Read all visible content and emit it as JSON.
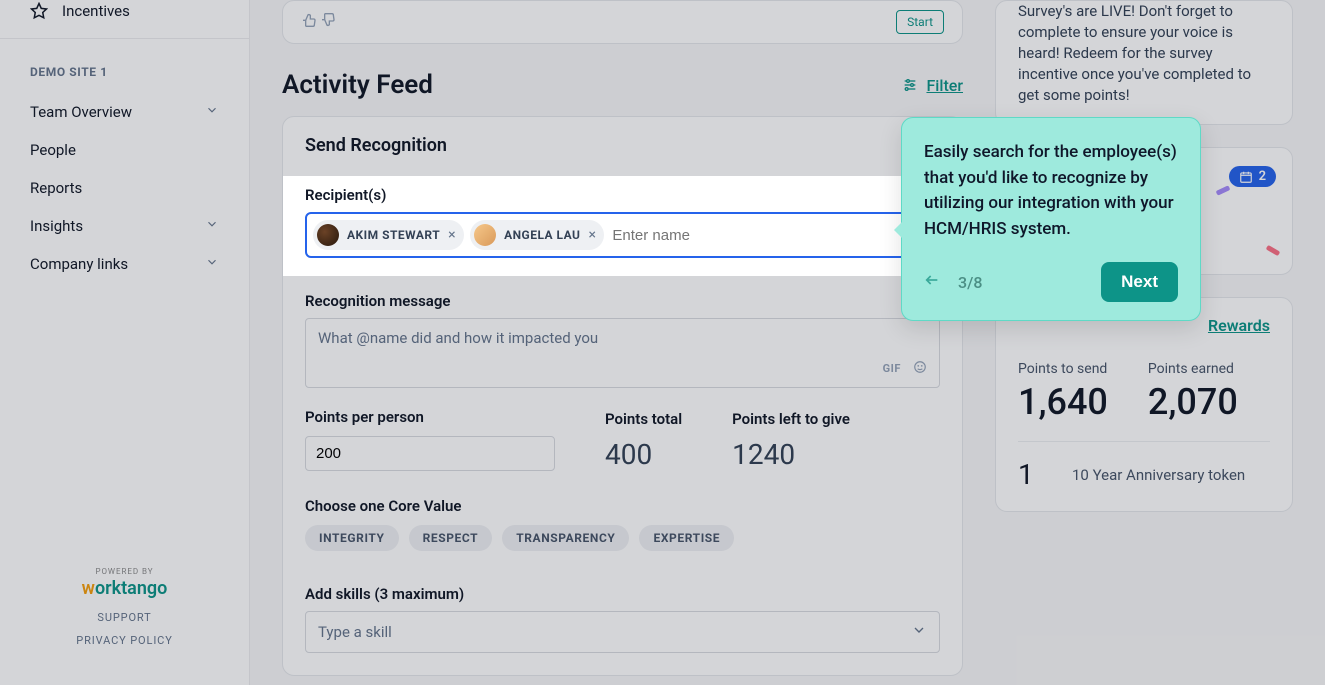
{
  "sidebar": {
    "incentives_label": "Incentives",
    "site_label": "DEMO SITE 1",
    "items": [
      {
        "label": "Team Overview",
        "expandable": true
      },
      {
        "label": "People",
        "expandable": false
      },
      {
        "label": "Reports",
        "expandable": false
      },
      {
        "label": "Insights",
        "expandable": true
      },
      {
        "label": "Company links",
        "expandable": true
      }
    ],
    "powered_by": "POWERED BY",
    "brand_pre": "w",
    "brand_rest": "orktango",
    "support": "SUPPORT",
    "privacy": "PRIVACY POLICY"
  },
  "main": {
    "ghost_start": "Start",
    "feed_title": "Activity Feed",
    "filter_label": "Filter",
    "card_title": "Send Recognition",
    "recipients_label": "Recipient(s)",
    "recipients": [
      {
        "name": "AKIM STEWART"
      },
      {
        "name": "ANGELA LAU"
      }
    ],
    "recipient_placeholder": "Enter name",
    "message_label": "Recognition message",
    "message_placeholder": "What @name did and how it impacted you",
    "gif_label": "GIF",
    "points_per_label": "Points per person",
    "points_per_value": "200",
    "points_total_label": "Points total",
    "points_total_value": "400",
    "points_left_label": "Points left to give",
    "points_left_value": "1240",
    "core_value_label": "Choose one Core Value",
    "core_values": [
      "INTEGRITY",
      "RESPECT",
      "TRANSPARENCY",
      "EXPERTISE"
    ],
    "skills_label": "Add skills (3 maximum)",
    "skills_placeholder": "Type a skill"
  },
  "right": {
    "survey_text": "Survey's are LIVE! Don't forget to complete to ensure your voice is heard! Redeem for the survey incentive once you've completed to get some points!",
    "badge_count": "2",
    "rewards_link": "Rewards",
    "points_send_label": "Points to send",
    "points_send_value": "1,640",
    "points_earned_label": "Points earned",
    "points_earned_value": "2,070",
    "anniv_count": "1",
    "anniv_text": "10 Year Anniversary token"
  },
  "tooltip": {
    "text": "Easily search for the employee(s) that you'd like to recognize by utilizing our integration with your HCM/HRIS system.",
    "step": "3/8",
    "next": "Next"
  }
}
